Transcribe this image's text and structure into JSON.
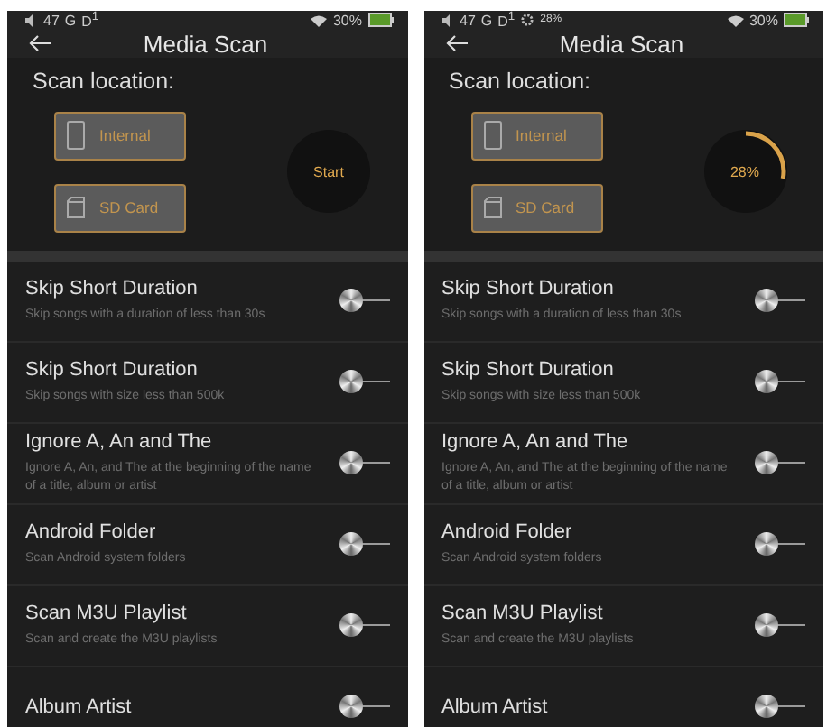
{
  "screens": [
    {
      "status_bar": {
        "volume": "47",
        "network": "G",
        "sim": "D$^{1}$",
        "battery": "30%"
      },
      "title": "Media Scan",
      "scan_label": "Scan location:",
      "locations": [
        {
          "kind": "internal",
          "label": "Internal"
        },
        {
          "kind": "sd",
          "label": "SD Card"
        }
      ],
      "scan_button": {
        "kind": "start",
        "label": "Start"
      },
      "settings": [
        {
          "title": "Skip Short Duration",
          "description": "Skip songs with a duration of less than 30s",
          "on": false
        },
        {
          "title": "Skip Short Duration",
          "description": "Skip songs with size less than 500k",
          "on": false
        },
        {
          "title": "Ignore A, An and The",
          "description": "Ignore A, An, and The at the beginning of the name of a title, album or artist",
          "on": false
        },
        {
          "title": "Android Folder",
          "description": "Scan Android system folders",
          "on": false
        },
        {
          "title": "Scan M3U Playlist",
          "description": "Scan and create the M3U playlists",
          "on": false
        },
        {
          "title": "Album Artist",
          "on": false
        }
      ]
    },
    {
      "status_bar": {
        "volume": "47",
        "network": "G",
        "sim": "D$^{1}$",
        "extra": "28%",
        "battery": "30%"
      },
      "title": "Media Scan",
      "scan_label": "Scan location:",
      "locations": [
        {
          "kind": "internal",
          "label": "Internal"
        },
        {
          "kind": "sd",
          "label": "SD Card"
        }
      ],
      "scan_button": {
        "kind": "progress",
        "label": "28%",
        "level": 0.28
      },
      "settings": [
        {
          "title": "Skip Short Duration",
          "description": "Skip songs with a duration of less than 30s",
          "on": false
        },
        {
          "title": "Skip Short Duration",
          "description": "Skip songs with size less than 500k",
          "on": false
        },
        {
          "title": "Ignore A, An and The",
          "description": "Ignore A, An, and The at the beginning of the name of a title, album or artist",
          "on": false
        },
        {
          "title": "Android Folder",
          "description": "Scan Android system folders",
          "on": false
        },
        {
          "title": "Scan M3U Playlist",
          "description": "Scan and create the M3U playlists",
          "on": false
        },
        {
          "title": "Album Artist",
          "on": false
        }
      ]
    }
  ]
}
